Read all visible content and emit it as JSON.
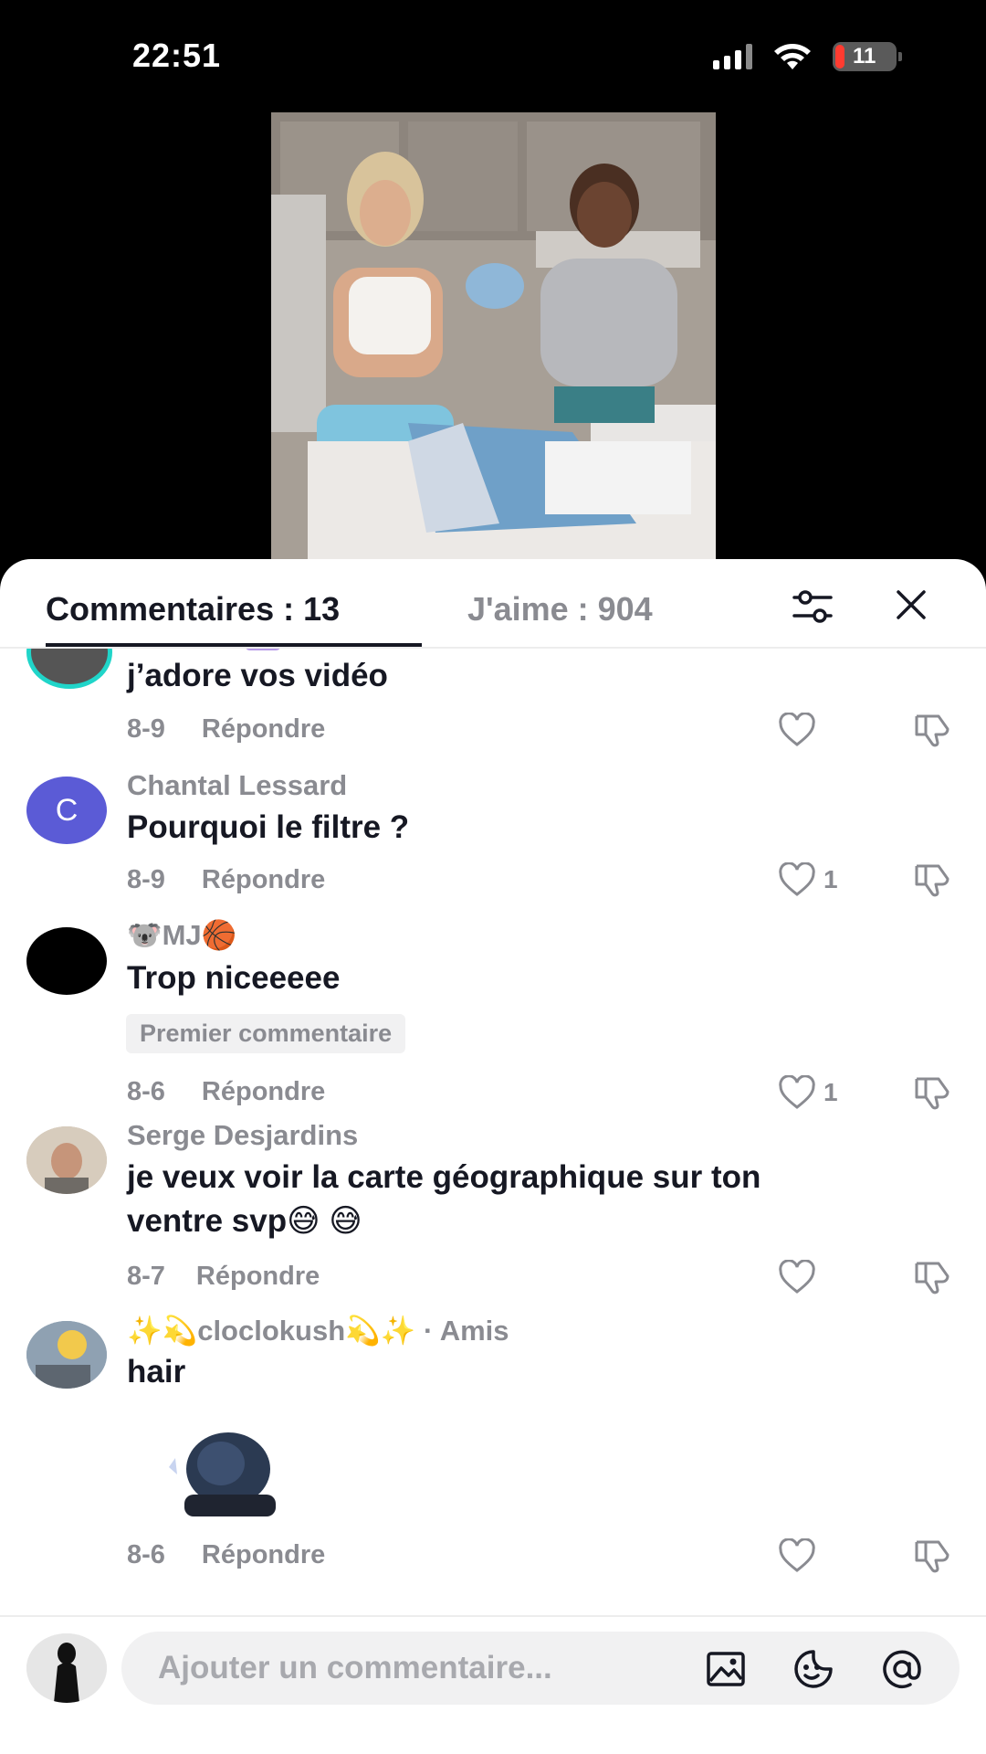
{
  "status_bar": {
    "time": "22:51",
    "battery": "11"
  },
  "video": {
    "description_icon": "video-thumbnail"
  },
  "tabs": {
    "comments": "Commentaires : 13",
    "likes": "J'aime : 904"
  },
  "comments": [
    {
      "author": "",
      "text": "j’adore vos vidéo",
      "date": "8-9",
      "reply": "Répondre",
      "likes": ""
    },
    {
      "author": "Chantal Lessard",
      "avatar_letter": "C",
      "text": "Pourquoi le filtre ?",
      "date": "8-9",
      "reply": "Répondre",
      "likes": "1"
    },
    {
      "author_prefix": "🐨",
      "author": "MJ",
      "author_suffix": "🏀",
      "text": "Trop niceeeee",
      "badge": "Premier commentaire",
      "date": "8-6",
      "reply": "Répondre",
      "likes": "1"
    },
    {
      "author": "Serge Desjardins",
      "text_line1": "je veux voir la carte géographique sur ton",
      "text_line2": "ventre svp😅 😅",
      "date": "8-7",
      "reply": "Répondre",
      "likes": ""
    },
    {
      "author": "✨💫cloclokush💫✨",
      "author_tag": " · Amis",
      "text": "hair",
      "date": "8-6",
      "reply": "Répondre",
      "likes": ""
    }
  ],
  "input": {
    "placeholder": "Ajouter un commentaire..."
  },
  "colors": {
    "text": "#161823",
    "muted": "#8a8b91",
    "avatar_purple": "#5b5bd6",
    "ring": "#20d5c9"
  }
}
